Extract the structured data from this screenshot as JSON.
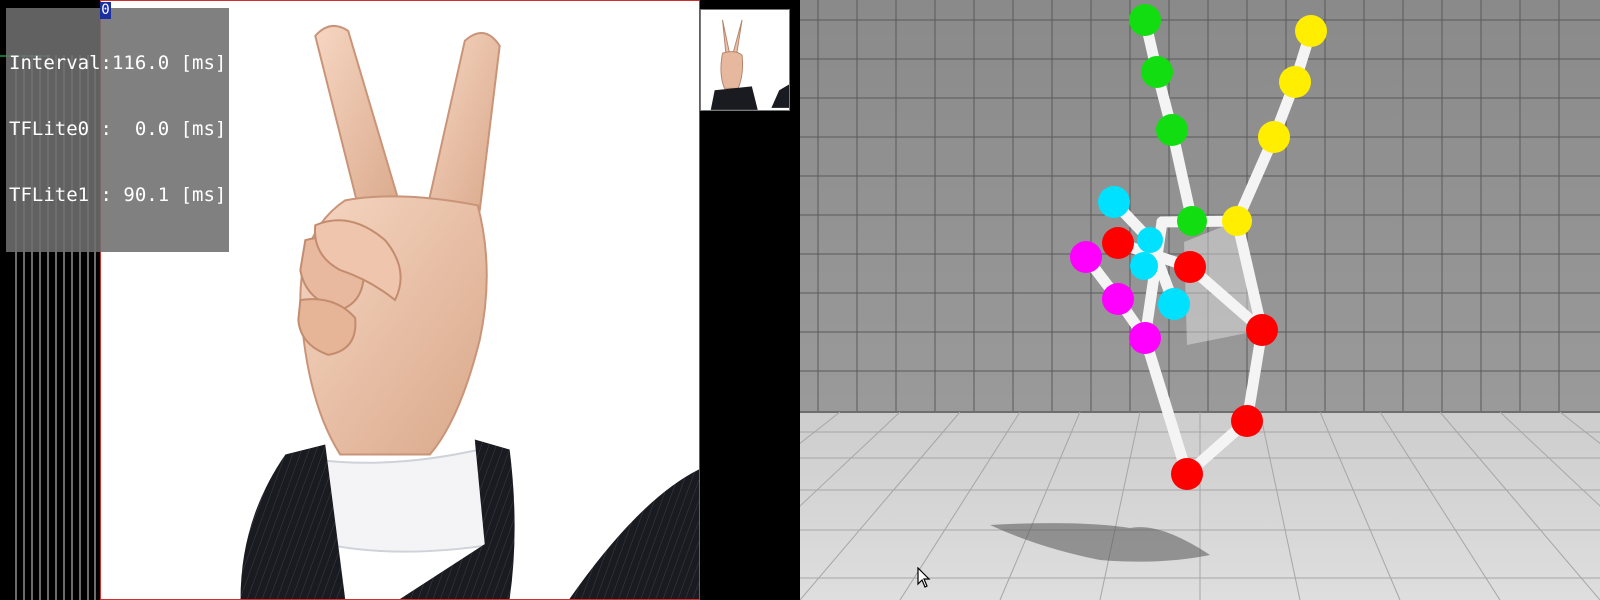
{
  "perf": {
    "lines": [
      "Interval:116.0 [ms]",
      "TFLite0 :  0.0 [ms]",
      "TFLite1 : 90.1 [ms]"
    ]
  },
  "roi": {
    "index_label": "0"
  },
  "icons": {
    "cursor": "mouse-pointer-icon",
    "thumbnail": "hand-thumbnail-icon"
  },
  "colors": {
    "thumb": "#ff0000",
    "index": "#00ee00",
    "middle": "#ffee00",
    "ring": "#00e5ff",
    "pinky": "#ff00ff",
    "bones": "#ffffff",
    "frame_border": "#d03030"
  }
}
